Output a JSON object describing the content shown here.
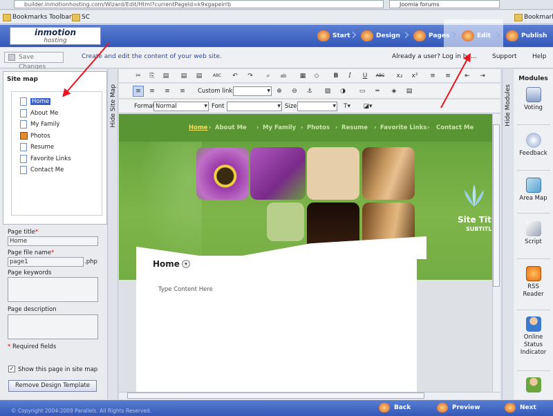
{
  "browser": {
    "url": "builder.inmotionhosting.com/Wizard/Edit/Html?currentPageId=k9xgapeirrb",
    "search": "Joomla forums",
    "bookmarks": [
      "Bookmarks Toolbar",
      "SC"
    ],
    "bookmarks_right": "Bookmark"
  },
  "header": {
    "logo_line1": "inmotion",
    "logo_line2": "hosting",
    "steps": [
      "Start",
      "Design",
      "Pages",
      "Edit",
      "Publish"
    ],
    "active_step": "Edit"
  },
  "actionbar": {
    "save_label": "Save Changes",
    "create_text": "Create and edit the content of your web site.",
    "already_text": "Already a user? Log in he...",
    "support_label": "Support",
    "help_label": "Help"
  },
  "sitemap": {
    "title": "Site map",
    "pages": [
      "Home",
      "About Me",
      "My Family",
      "Photos",
      "Resume",
      "Favorite Links",
      "Contact Me"
    ],
    "selected": "Home",
    "hide_label": "Hide Site Map"
  },
  "pageprops": {
    "title_label": "Page title",
    "title_value": "Home",
    "filename_label": "Page file name",
    "filename_value": "page1",
    "filename_ext": ".php",
    "keywords_label": "Page keywords",
    "description_label": "Page description",
    "required_note": "Required fields",
    "required_star": "*",
    "show_in_map": "Show this page in site map",
    "remove_template": "Remove Design Template"
  },
  "toolbar": {
    "custom_links_label": "Custom links",
    "format_label": "Format",
    "format_value": "Normal",
    "font_label": "Font",
    "size_label": "Size",
    "buttons_row1": [
      "✂",
      "⎘",
      "📋",
      "📋",
      "📋",
      "ABC",
      "↶",
      "↷",
      "🔭",
      "ab",
      "▦",
      "◇",
      "B",
      "I",
      "U",
      "ABC",
      "x₂",
      "x²",
      "≡",
      "≡"
    ]
  },
  "site": {
    "nav": [
      "Home",
      "About Me",
      "My Family",
      "Photos",
      "Resume",
      "Favorite Links",
      "Contact Me"
    ],
    "site_title": "Site Tit",
    "subtitle": "SUBTITLE",
    "page_heading": "Home",
    "content_placeholder": "Type Content Here"
  },
  "modules": {
    "title": "Modules",
    "hide_label": "Hide Modules",
    "items": [
      "Voting",
      "Feedback",
      "Area Map",
      "Script",
      "RSS Reader",
      "Online Status Indicator"
    ]
  },
  "footer": {
    "copyright": "© Copyright 2004-2009 Parallels. All Rights Reserved.",
    "back": "Back",
    "preview": "Preview",
    "next": "Next"
  },
  "colors": {
    "header_blue": "#3358b8",
    "site_green": "#6aa63e",
    "annotation_red": "#e8141e"
  }
}
